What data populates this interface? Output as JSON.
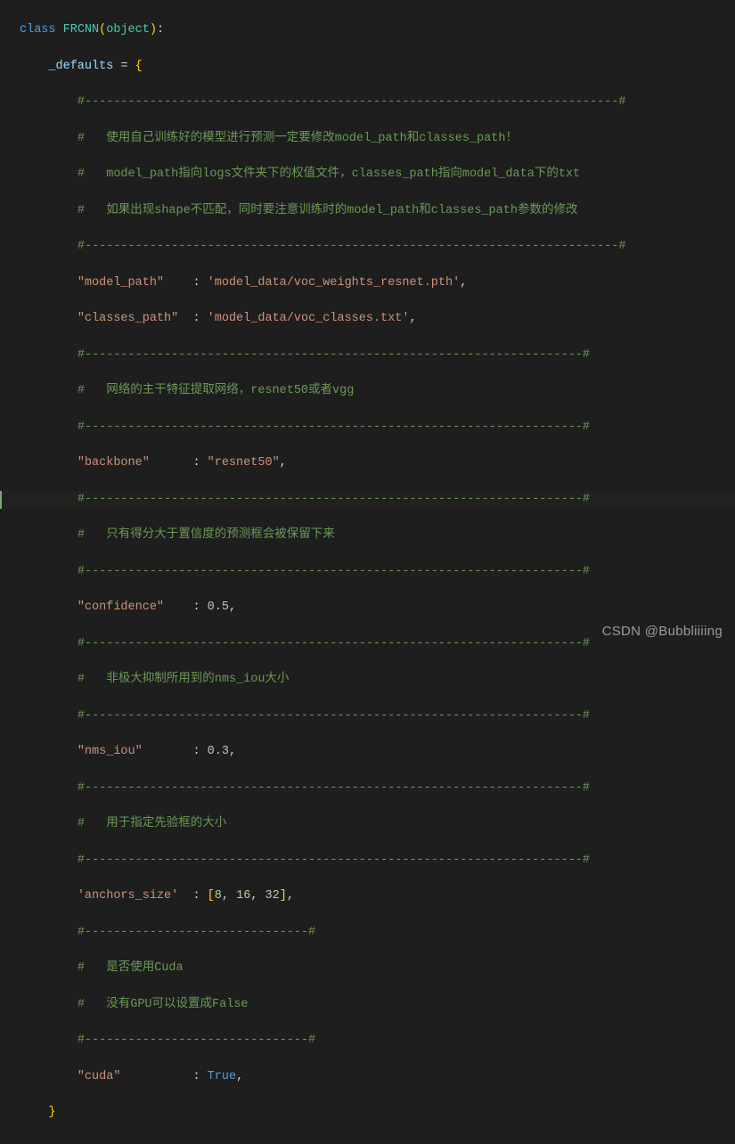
{
  "language": "python",
  "class_name": "FRCNN",
  "base_class": "object",
  "class_kw": "class",
  "attr_name": "_defaults",
  "sep_long": "#--------------------------------------------------------------------------#",
  "sep_med": "#---------------------------------------------------------------------#",
  "sep_short": "#-------------------------------#",
  "c1a": "#   使用自己训练好的模型进行预测一定要修改model_path和classes_path！",
  "c1b": "#   model_path指向logs文件夹下的权值文件，classes_path指向model_data下的txt",
  "c1c": "#   如果出现shape不匹配，同时要注意训练时的model_path和classes_path参数的修改",
  "c2": "#   网络的主干特征提取网络，resnet50或者vgg",
  "c3": "#   只有得分大于置信度的预测框会被保留下来",
  "c4": "#   非极大抑制所用到的nms_iou大小",
  "c5": "#   用于指定先验框的大小",
  "c6a": "#   是否使用Cuda",
  "c6b": "#   没有GPU可以设置成False",
  "keys": {
    "model_path": "\"model_path\"",
    "classes_path": "\"classes_path\"",
    "backbone": "\"backbone\"",
    "confidence": "\"confidence\"",
    "nms_iou": "\"nms_iou\"",
    "anchors_size": "'anchors_size'",
    "cuda": "\"cuda\""
  },
  "vals": {
    "model_path": "'model_data/voc_weights_resnet.pth'",
    "classes_path": "'model_data/voc_classes.txt'",
    "backbone": "\"resnet50\"",
    "confidence": "0.5",
    "nms_iou": "0.3",
    "anchors_v1": "8",
    "anchors_v2": "16",
    "anchors_v3": "32",
    "cuda": "True"
  },
  "watermark": "CSDN @Bubbliiiing"
}
